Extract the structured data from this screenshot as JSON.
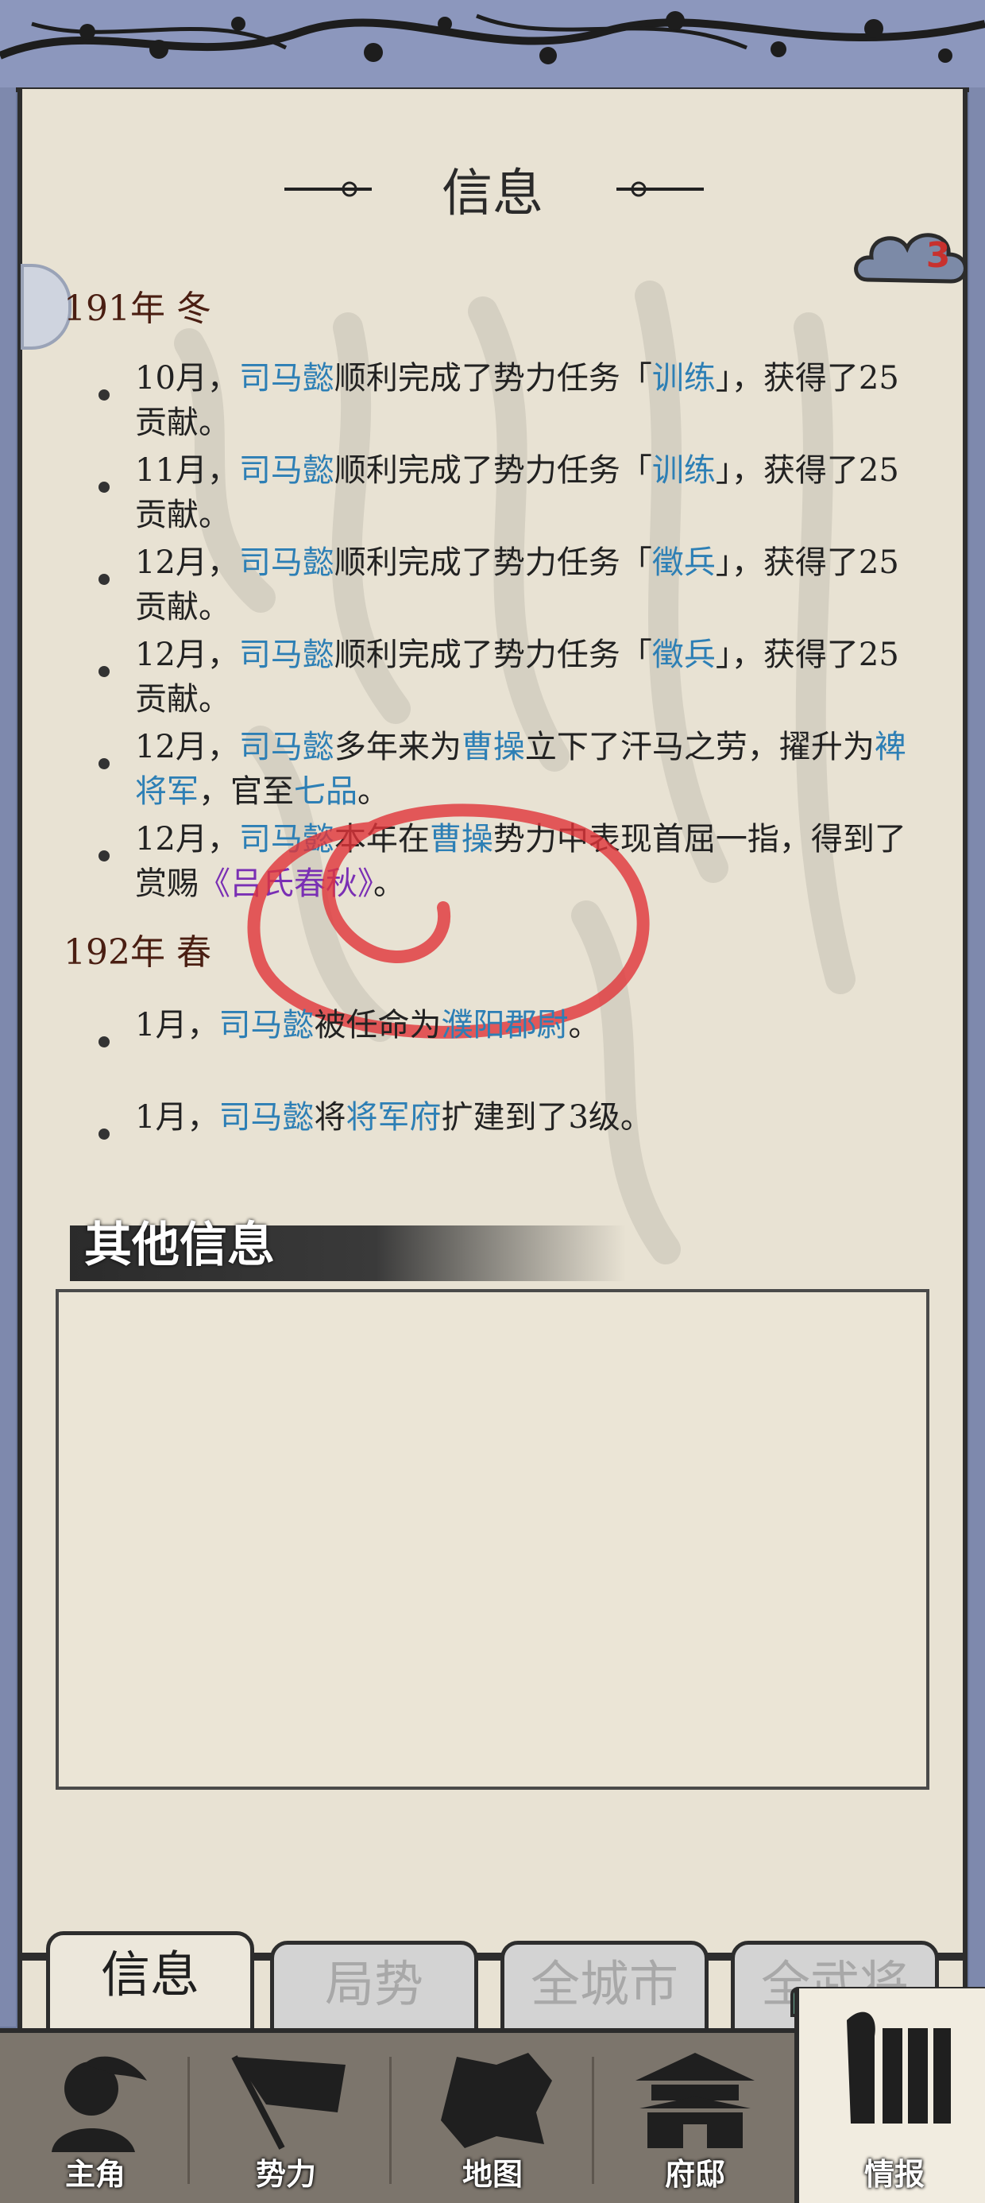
{
  "header": {
    "title": "信息",
    "badge_count": "3"
  },
  "sections": [
    {
      "season": "191年 冬",
      "entries": [
        {
          "pre": "10月，",
          "name": "司马懿",
          "mid": "顺利完成了势力任务「",
          "task": "训练",
          "post": "」，获得了25贡献。"
        },
        {
          "pre": "11月，",
          "name": "司马懿",
          "mid": "顺利完成了势力任务「",
          "task": "训练",
          "post": "」，获得了25贡献。"
        },
        {
          "pre": "12月，",
          "name": "司马懿",
          "mid": "顺利完成了势力任务「",
          "task": "徵兵",
          "post": "」，获得了25贡献。"
        },
        {
          "pre": "12月，",
          "name": "司马懿",
          "mid": "顺利完成了势力任务「",
          "task": "徵兵",
          "post": "」，获得了25贡献。"
        },
        {
          "pre": "12月，",
          "name": "司马懿",
          "mid": "多年来为",
          "lord": "曹操",
          "mid2": "立下了汗马之劳，擢升为",
          "title": "裨将军",
          "mid3": "，官至",
          "rank": "七品",
          "post": "。"
        },
        {
          "pre": "12月，",
          "name": "司马懿",
          "mid": "本年在",
          "lord": "曹操",
          "mid2": "势力中表现首屈一指，得到了赏赐",
          "book": "《吕氏春秋》",
          "post": "。"
        }
      ]
    },
    {
      "season": "192年 春",
      "entries": [
        {
          "pre": "1月，",
          "name": "司马懿",
          "mid": "被任命为",
          "office": "濮阳郡尉",
          "post": "。"
        },
        {
          "pre": "1月，",
          "name": "司马懿",
          "mid": "将",
          "building": "将军府",
          "post": "扩建到了3级。"
        }
      ]
    }
  ],
  "other": {
    "title": "其他信息"
  },
  "tabs": [
    "信息",
    "局势",
    "全城市",
    "全武将"
  ],
  "nav": [
    "主角",
    "势力",
    "地图",
    "府邸",
    "情报"
  ],
  "colors": {
    "highlight": "#2d7fb5",
    "book": "#7a2fb4",
    "season": "#4a1e12",
    "badge": "#c8312e"
  }
}
